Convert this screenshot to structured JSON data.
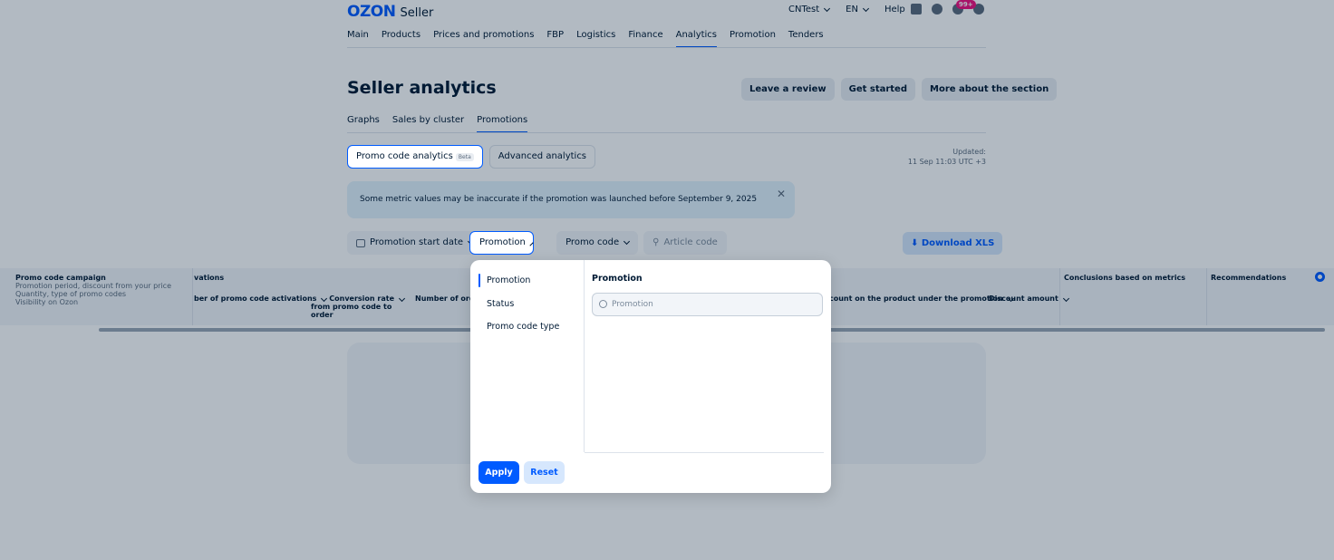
{
  "header": {
    "logo_text": "OZON",
    "logo_sub": "Seller",
    "account": "CNTest",
    "language": "EN",
    "help": "Help",
    "notifications_badge": "99+"
  },
  "nav": [
    "Main",
    "Products",
    "Prices and promotions",
    "FBP",
    "Logistics",
    "Finance",
    "Analytics",
    "Promotion",
    "Tenders"
  ],
  "page": {
    "title": "Seller analytics",
    "buttons": [
      "Leave a review",
      "Get started",
      "More about the section"
    ]
  },
  "tabs": [
    "Graphs",
    "Sales by cluster",
    "Promotions"
  ],
  "segments": {
    "promo_label": "Promo code analytics",
    "beta": "Beta",
    "advanced": "Advanced analytics"
  },
  "updated": {
    "label": "Updated:",
    "value": "11 Sep 11:03 UTC +3"
  },
  "alert": "Some metric values may be inaccurate if the promotion was launched before September 9, 2025",
  "filters": {
    "start_date": "Promotion start date",
    "promotion": "Promotion",
    "promo_code": "Promo code",
    "article_code": "Article code",
    "download": "Download XLS"
  },
  "table": {
    "first_col": {
      "title": "Promo code campaign",
      "lines": [
        "Promotion period, discount from your price",
        "Quantity, type of promo codes",
        "Visibility on Ozon"
      ]
    },
    "group_label": "vations",
    "headers": [
      "ber of promo code activations",
      "Conversion rate",
      "from promo code to order",
      "Number of orders",
      "count on the product under the promotion",
      "Discount amount",
      "Conclusions based on metrics",
      "Recommendations"
    ]
  },
  "dropdown": {
    "options": [
      "Promotion",
      "Status",
      "Promo code type"
    ],
    "panel_title": "Promotion",
    "search_placeholder": "Promotion",
    "apply": "Apply",
    "reset": "Reset"
  }
}
